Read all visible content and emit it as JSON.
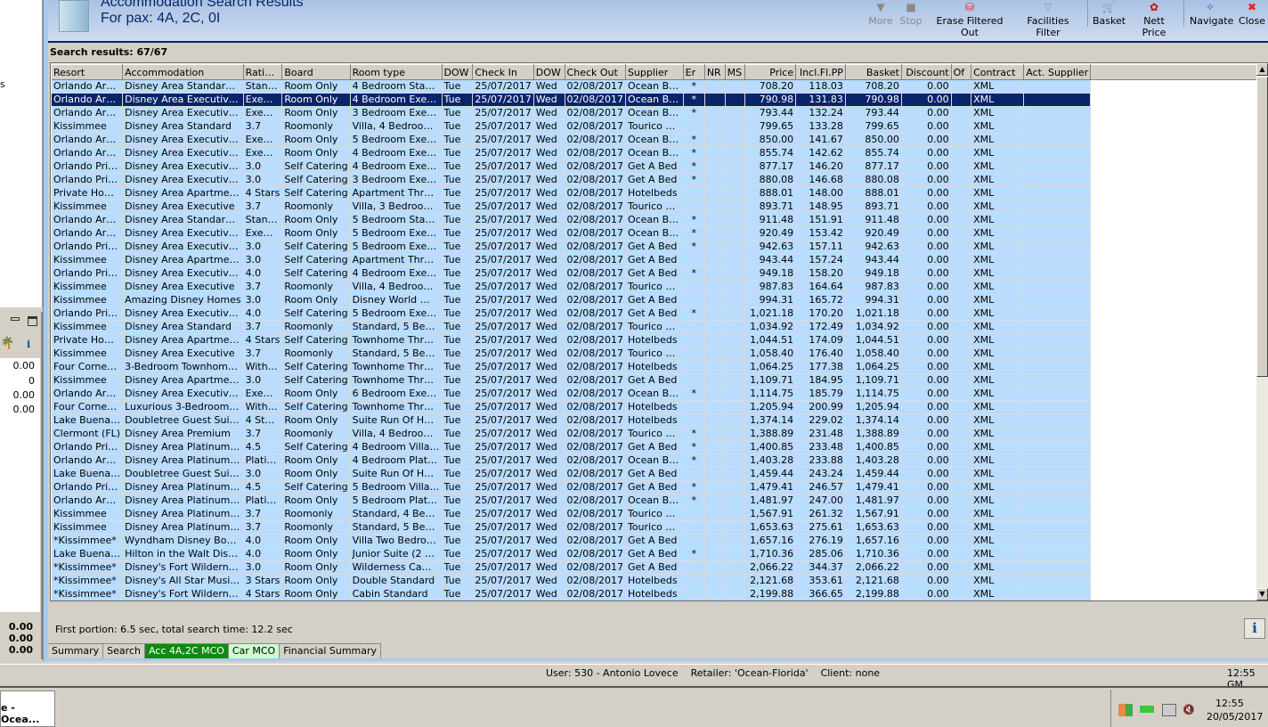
{
  "left_panel": {
    "partial_text": "s",
    "values": [
      "0.00",
      "0",
      "0.00",
      "0.00"
    ],
    "totals": [
      "0.00",
      "0.00",
      "0.00"
    ]
  },
  "header": {
    "title": "Accommodation Search Results",
    "subtitle": "For pax: 4A, 2C, 0I"
  },
  "toolbar": {
    "more": "More",
    "stop": "Stop",
    "erase": "Erase Filtered Out",
    "facilities": "Facilities Filter",
    "basket": "Basket",
    "nett": "Nett Price",
    "navigate": "Navigate",
    "close": "Close"
  },
  "results_label": "Search results: 67/67",
  "columns": [
    "Resort",
    "Accommodation",
    "Rati…",
    "Board",
    "Room type",
    "DOW",
    "Check In",
    "DOW",
    "Check Out",
    "Supplier",
    "Er",
    "NR",
    "MS",
    "Price",
    "Incl.Fl.PP",
    "Basket",
    "Discount",
    "Of",
    "Contract",
    "Act. Supplier"
  ],
  "selected_row": 1,
  "rows": [
    [
      "Orlando Ar…",
      "Disney Area Standar…",
      "Stan…",
      "Room Only",
      "4 Bedroom Sta…",
      "Tue",
      "25/07/2017",
      "Wed",
      "02/08/2017",
      "Ocean B…",
      "*",
      "",
      "",
      "708.20",
      "118.03",
      "708.20",
      "0.00",
      "",
      "XML",
      ""
    ],
    [
      "Orlando Ar…",
      "Disney Area Executiv…",
      "Exe…",
      "Room Only",
      "4 Bedroom Exe…",
      "Tue",
      "25/07/2017",
      "Wed",
      "02/08/2017",
      "Ocean B…",
      "*",
      "",
      "",
      "790.98",
      "131.83",
      "790.98",
      "0.00",
      "",
      "XML",
      ""
    ],
    [
      "Orlando Ar…",
      "Disney Area Executiv…",
      "Exe…",
      "Room Only",
      "3 Bedroom Exe…",
      "Tue",
      "25/07/2017",
      "Wed",
      "02/08/2017",
      "Ocean B…",
      "*",
      "",
      "",
      "793.44",
      "132.24",
      "793.44",
      "0.00",
      "",
      "XML",
      ""
    ],
    [
      "Kissimmee",
      "Disney Area Standard",
      "3.7",
      "Roomonly",
      "Villa, 4 Bedroo…",
      "Tue",
      "25/07/2017",
      "Wed",
      "02/08/2017",
      "Tourico …",
      "",
      "",
      "",
      "799.65",
      "133.28",
      "799.65",
      "0.00",
      "",
      "XML",
      ""
    ],
    [
      "Orlando Ar…",
      "Disney Area Executiv…",
      "Exe…",
      "Room Only",
      "5 Bedroom Exe…",
      "Tue",
      "25/07/2017",
      "Wed",
      "02/08/2017",
      "Ocean B…",
      "*",
      "",
      "",
      "850.00",
      "141.67",
      "850.00",
      "0.00",
      "",
      "XML",
      ""
    ],
    [
      "Orlando Ar…",
      "Disney Area Executiv…",
      "Exe…",
      "Room Only",
      "4 Bedroom Exe…",
      "Tue",
      "25/07/2017",
      "Wed",
      "02/08/2017",
      "Ocean B…",
      "*",
      "",
      "",
      "855.74",
      "142.62",
      "855.74",
      "0.00",
      "",
      "XML",
      ""
    ],
    [
      "Orlando Pri…",
      "Disney Area Executiv…",
      "3.0",
      "Self Catering",
      "4 Bedroom Exe…",
      "Tue",
      "25/07/2017",
      "Wed",
      "02/08/2017",
      "Get A Bed",
      "*",
      "",
      "",
      "877.17",
      "146.20",
      "877.17",
      "0.00",
      "",
      "XML",
      ""
    ],
    [
      "Orlando Pri…",
      "Disney Area Executiv…",
      "3.0",
      "Self Catering",
      "3 Bedroom Exe…",
      "Tue",
      "25/07/2017",
      "Wed",
      "02/08/2017",
      "Get A Bed",
      "*",
      "",
      "",
      "880.08",
      "146.68",
      "880.08",
      "0.00",
      "",
      "XML",
      ""
    ],
    [
      "Private Ho…",
      "Disney Area Apartme…",
      "4 Stars",
      "Self Catering",
      "Apartment Thr…",
      "Tue",
      "25/07/2017",
      "Wed",
      "02/08/2017",
      "Hotelbeds",
      "",
      "",
      "",
      "888.01",
      "148.00",
      "888.01",
      "0.00",
      "",
      "XML",
      ""
    ],
    [
      "Kissimmee",
      "Disney Area Executive",
      "3.7",
      "Roomonly",
      "Villa, 3 Bedroo…",
      "Tue",
      "25/07/2017",
      "Wed",
      "02/08/2017",
      "Tourico …",
      "",
      "",
      "",
      "893.71",
      "148.95",
      "893.71",
      "0.00",
      "",
      "XML",
      ""
    ],
    [
      "Orlando Ar…",
      "Disney Area Standar…",
      "Stan…",
      "Room Only",
      "5 Bedroom Sta…",
      "Tue",
      "25/07/2017",
      "Wed",
      "02/08/2017",
      "Ocean B…",
      "*",
      "",
      "",
      "911.48",
      "151.91",
      "911.48",
      "0.00",
      "",
      "XML",
      ""
    ],
    [
      "Orlando Ar…",
      "Disney Area Executiv…",
      "Exe…",
      "Room Only",
      "5 Bedroom Exe…",
      "Tue",
      "25/07/2017",
      "Wed",
      "02/08/2017",
      "Ocean B…",
      "*",
      "",
      "",
      "920.49",
      "153.42",
      "920.49",
      "0.00",
      "",
      "XML",
      ""
    ],
    [
      "Orlando Pri…",
      "Disney Area Executiv…",
      "3.0",
      "Self Catering",
      "5 Bedroom Exe…",
      "Tue",
      "25/07/2017",
      "Wed",
      "02/08/2017",
      "Get A Bed",
      "*",
      "",
      "",
      "942.63",
      "157.11",
      "942.63",
      "0.00",
      "",
      "XML",
      ""
    ],
    [
      "Kissimmee",
      "Disney Area Apartme…",
      "3.0",
      "Self Catering",
      "Apartment Thr…",
      "Tue",
      "25/07/2017",
      "Wed",
      "02/08/2017",
      "Get A Bed",
      "",
      "",
      "",
      "943.44",
      "157.24",
      "943.44",
      "0.00",
      "",
      "XML",
      ""
    ],
    [
      "Orlando Pri…",
      "Disney Area Executiv…",
      "4.0",
      "Self Catering",
      "4 Bedroom Exe…",
      "Tue",
      "25/07/2017",
      "Wed",
      "02/08/2017",
      "Get A Bed",
      "*",
      "",
      "",
      "949.18",
      "158.20",
      "949.18",
      "0.00",
      "",
      "XML",
      ""
    ],
    [
      "Kissimmee",
      "Disney Area Executive",
      "3.7",
      "Roomonly",
      "Villa, 4 Bedroo…",
      "Tue",
      "25/07/2017",
      "Wed",
      "02/08/2017",
      "Tourico …",
      "",
      "",
      "",
      "987.83",
      "164.64",
      "987.83",
      "0.00",
      "",
      "XML",
      ""
    ],
    [
      "Kissimmee",
      "Amazing Disney Homes",
      "3.0",
      "Room Only",
      "Disney World …",
      "Tue",
      "25/07/2017",
      "Wed",
      "02/08/2017",
      "Get A Bed",
      "",
      "",
      "",
      "994.31",
      "165.72",
      "994.31",
      "0.00",
      "",
      "XML",
      ""
    ],
    [
      "Orlando Pri…",
      "Disney Area Executiv…",
      "4.0",
      "Self Catering",
      "5 Bedroom Exe…",
      "Tue",
      "25/07/2017",
      "Wed",
      "02/08/2017",
      "Get A Bed",
      "*",
      "",
      "",
      "1,021.18",
      "170.20",
      "1,021.18",
      "0.00",
      "",
      "XML",
      ""
    ],
    [
      "Kissimmee",
      "Disney Area Standard",
      "3.7",
      "Roomonly",
      "Standard, 5 Be…",
      "Tue",
      "25/07/2017",
      "Wed",
      "02/08/2017",
      "Tourico …",
      "",
      "",
      "",
      "1,034.92",
      "172.49",
      "1,034.92",
      "0.00",
      "",
      "XML",
      ""
    ],
    [
      "Private Ho…",
      "Disney Area Apartme…",
      "4 Stars",
      "Self Catering",
      "Townhome Thr…",
      "Tue",
      "25/07/2017",
      "Wed",
      "02/08/2017",
      "Hotelbeds",
      "",
      "",
      "",
      "1,044.51",
      "174.09",
      "1,044.51",
      "0.00",
      "",
      "XML",
      ""
    ],
    [
      "Kissimmee",
      "Disney Area Executive",
      "3.7",
      "Roomonly",
      "Standard, 5 Be…",
      "Tue",
      "25/07/2017",
      "Wed",
      "02/08/2017",
      "Tourico …",
      "",
      "",
      "",
      "1,058.40",
      "176.40",
      "1,058.40",
      "0.00",
      "",
      "XML",
      ""
    ],
    [
      "Four Corne…",
      "3-Bedroom Townhom…",
      "With…",
      "Self Catering",
      "Townhome Thr…",
      "Tue",
      "25/07/2017",
      "Wed",
      "02/08/2017",
      "Hotelbeds",
      "",
      "",
      "",
      "1,064.25",
      "177.38",
      "1,064.25",
      "0.00",
      "",
      "XML",
      ""
    ],
    [
      "Kissimmee",
      "Disney Area Apartme…",
      "3.0",
      "Self Catering",
      "Townhome Thr…",
      "Tue",
      "25/07/2017",
      "Wed",
      "02/08/2017",
      "Get A Bed",
      "",
      "",
      "",
      "1,109.71",
      "184.95",
      "1,109.71",
      "0.00",
      "",
      "XML",
      ""
    ],
    [
      "Orlando Ar…",
      "Disney Area Executiv…",
      "Exe…",
      "Room Only",
      "6 Bedroom Exe…",
      "Tue",
      "25/07/2017",
      "Wed",
      "02/08/2017",
      "Ocean B…",
      "*",
      "",
      "",
      "1,114.75",
      "185.79",
      "1,114.75",
      "0.00",
      "",
      "XML",
      ""
    ],
    [
      "Four Corne…",
      "Luxurious 3-Bedroom…",
      "With…",
      "Self Catering",
      "Townhome Thr…",
      "Tue",
      "25/07/2017",
      "Wed",
      "02/08/2017",
      "Hotelbeds",
      "",
      "",
      "",
      "1,205.94",
      "200.99",
      "1,205.94",
      "0.00",
      "",
      "XML",
      ""
    ],
    [
      "Lake Buena…",
      "Doubletree Guest Sui…",
      "4 St…",
      "Room Only",
      "Suite Run Of H…",
      "Tue",
      "25/07/2017",
      "Wed",
      "02/08/2017",
      "Hotelbeds",
      "",
      "",
      "",
      "1,374.14",
      "229.02",
      "1,374.14",
      "0.00",
      "",
      "XML",
      ""
    ],
    [
      "Clermont (FL)",
      "Disney Area Premium",
      "3.7",
      "Roomonly",
      "Villa, 4 Bedroo…",
      "Tue",
      "25/07/2017",
      "Wed",
      "02/08/2017",
      "Tourico …",
      "*",
      "",
      "",
      "1,388.89",
      "231.48",
      "1,388.89",
      "0.00",
      "",
      "XML",
      ""
    ],
    [
      "Orlando Pri…",
      "Disney Area Platinum…",
      "4.5",
      "Self Catering",
      "4 Bedroom Villa…",
      "Tue",
      "25/07/2017",
      "Wed",
      "02/08/2017",
      "Get A Bed",
      "*",
      "",
      "",
      "1,400.85",
      "233.48",
      "1,400.85",
      "0.00",
      "",
      "XML",
      ""
    ],
    [
      "Orlando Ar…",
      "Disney Area Platinum…",
      "Plati…",
      "Room Only",
      "4 Bedroom Plat…",
      "Tue",
      "25/07/2017",
      "Wed",
      "02/08/2017",
      "Ocean B…",
      "*",
      "",
      "",
      "1,403.28",
      "233.88",
      "1,403.28",
      "0.00",
      "",
      "XML",
      ""
    ],
    [
      "Lake Buena…",
      "Doubletree Guest Sui…",
      "3.0",
      "Room Only",
      "Suite Run Of H…",
      "Tue",
      "25/07/2017",
      "Wed",
      "02/08/2017",
      "Get A Bed",
      "",
      "",
      "",
      "1,459.44",
      "243.24",
      "1,459.44",
      "0.00",
      "",
      "XML",
      ""
    ],
    [
      "Orlando Pri…",
      "Disney Area Platinum…",
      "4.5",
      "Self Catering",
      "5 Bedroom Villa…",
      "Tue",
      "25/07/2017",
      "Wed",
      "02/08/2017",
      "Get A Bed",
      "*",
      "",
      "",
      "1,479.41",
      "246.57",
      "1,479.41",
      "0.00",
      "",
      "XML",
      ""
    ],
    [
      "Orlando Ar…",
      "Disney Area Platinum…",
      "Plati…",
      "Room Only",
      "5 Bedroom Plat…",
      "Tue",
      "25/07/2017",
      "Wed",
      "02/08/2017",
      "Ocean B…",
      "*",
      "",
      "",
      "1,481.97",
      "247.00",
      "1,481.97",
      "0.00",
      "",
      "XML",
      ""
    ],
    [
      "Kissimmee",
      "Disney Area Platinum…",
      "3.7",
      "Roomonly",
      "Standard, 4 Be…",
      "Tue",
      "25/07/2017",
      "Wed",
      "02/08/2017",
      "Tourico …",
      "",
      "",
      "",
      "1,567.91",
      "261.32",
      "1,567.91",
      "0.00",
      "",
      "XML",
      ""
    ],
    [
      "Kissimmee",
      "Disney Area Platinum…",
      "3.7",
      "Roomonly",
      "Standard, 5 Be…",
      "Tue",
      "25/07/2017",
      "Wed",
      "02/08/2017",
      "Tourico …",
      "",
      "",
      "",
      "1,653.63",
      "275.61",
      "1,653.63",
      "0.00",
      "",
      "XML",
      ""
    ],
    [
      "*Kissimmee*",
      "Wyndham Disney Bo…",
      "4.0",
      "Room Only",
      "Villa Two Bedro…",
      "Tue",
      "25/07/2017",
      "Wed",
      "02/08/2017",
      "Get A Bed",
      "",
      "",
      "",
      "1,657.16",
      "276.19",
      "1,657.16",
      "0.00",
      "",
      "XML",
      ""
    ],
    [
      "Lake Buena…",
      "Hilton in the Walt Dis…",
      "4.0",
      "Room Only",
      "Junior Suite (2 …",
      "Tue",
      "25/07/2017",
      "Wed",
      "02/08/2017",
      "Get A Bed",
      "*",
      "",
      "",
      "1,710.36",
      "285.06",
      "1,710.36",
      "0.00",
      "",
      "XML",
      ""
    ],
    [
      "*Kissimmee*",
      "Disney's Fort Wildern…",
      "3.0",
      "Room Only",
      "Wilderness Ca…",
      "Tue",
      "25/07/2017",
      "Wed",
      "02/08/2017",
      "Get A Bed",
      "",
      "",
      "",
      "2,066.22",
      "344.37",
      "2,066.22",
      "0.00",
      "",
      "XML",
      ""
    ],
    [
      "*Kissimmee*",
      "Disney's All Star Musi…",
      "3 Stars",
      "Room Only",
      "Double Standard",
      "Tue",
      "25/07/2017",
      "Wed",
      "02/08/2017",
      "Hotelbeds",
      "",
      "",
      "",
      "2,121.68",
      "353.61",
      "2,121.68",
      "0.00",
      "",
      "XML",
      ""
    ],
    [
      "*Kissimmee*",
      "Disney's Fort Wildern…",
      "4 Stars",
      "Room Only",
      "Cabin Standard",
      "Tue",
      "25/07/2017",
      "Wed",
      "02/08/2017",
      "Hotelbeds",
      "",
      "",
      "",
      "2,199.88",
      "366.65",
      "2,199.88",
      "0.00",
      "",
      "XML",
      ""
    ]
  ],
  "timing": "First portion: 6.5 sec, total search time: 12.2 sec",
  "info_button": "i",
  "tabs": [
    "Summary",
    "Search",
    "Acc 4A,2C MCO",
    "Car MCO",
    "Financial Summary"
  ],
  "status": {
    "user": "User: 530 - Antonio Lovece    Retailer: 'Ocean-Florida'    Client: none",
    "time": "12:55 GM"
  },
  "taskbar": {
    "button": "e - Ocea...",
    "time": "12:55",
    "date": "20/05/2017"
  },
  "colors": {
    "row": "#b9dcff",
    "selected": "#0a246a",
    "active_tab": "#108a10",
    "green_tab": "#ccffcc"
  }
}
